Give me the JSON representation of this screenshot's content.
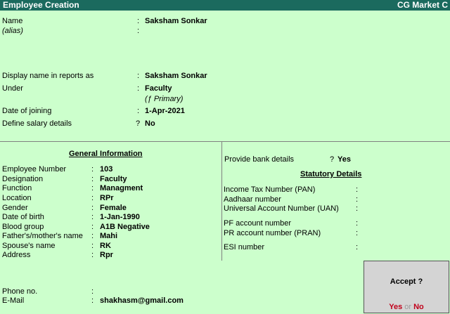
{
  "window": {
    "title": "Employee  Creation",
    "company": "CG Market C"
  },
  "top": {
    "name_label": "Name",
    "name_value": "Saksham Sonkar",
    "alias_label": "(alias)",
    "display_name_label": "Display name in reports as",
    "display_name_value": "Saksham Sonkar",
    "under_label": "Under",
    "under_value": "Faculty",
    "under_sub": "(ƒ Primary)",
    "doj_label": "Date of joining",
    "doj_value": "1-Apr-2021",
    "salary_label": "Define salary details",
    "salary_value": "No"
  },
  "general": {
    "title": "General Information",
    "fields": [
      {
        "label": "Employee Number",
        "value": "103"
      },
      {
        "label": "Designation",
        "value": "Faculty"
      },
      {
        "label": "Function",
        "value": "Managment"
      },
      {
        "label": "Location",
        "value": "RPr"
      },
      {
        "label": "Gender",
        "value": "Female"
      },
      {
        "label": "Date of birth",
        "value": "1-Jan-1990"
      },
      {
        "label": "Blood group",
        "value": "A1B Negative"
      },
      {
        "label": "Father's/mother's name",
        "value": "Mahi"
      },
      {
        "label": "Spouse's name",
        "value": "RK"
      },
      {
        "label": "Address",
        "value": "Rpr"
      }
    ],
    "phone_label": "Phone no.",
    "phone_value": "",
    "email_label": "E-Mail",
    "email_value": "shakhasm@gmail.com"
  },
  "bank": {
    "label": "Provide bank details",
    "value": "Yes"
  },
  "statutory": {
    "title": "Statutory Details",
    "fields": [
      {
        "label": "Income Tax Number (PAN)"
      },
      {
        "label": "Aadhaar number"
      },
      {
        "label": "Universal Account Number (UAN)"
      },
      {
        "label": "PF account number"
      },
      {
        "label": "PR account number (PRAN)"
      },
      {
        "label": "ESI number"
      }
    ]
  },
  "accept": {
    "question": "Accept ?",
    "yes": "Yes",
    "or": "or",
    "no": "No"
  },
  "colors": {
    "background": "#ccffcc",
    "titlebar": "#1b6a5e",
    "accept_box": "#d4d4d4",
    "yes_no": "#c0001a"
  }
}
